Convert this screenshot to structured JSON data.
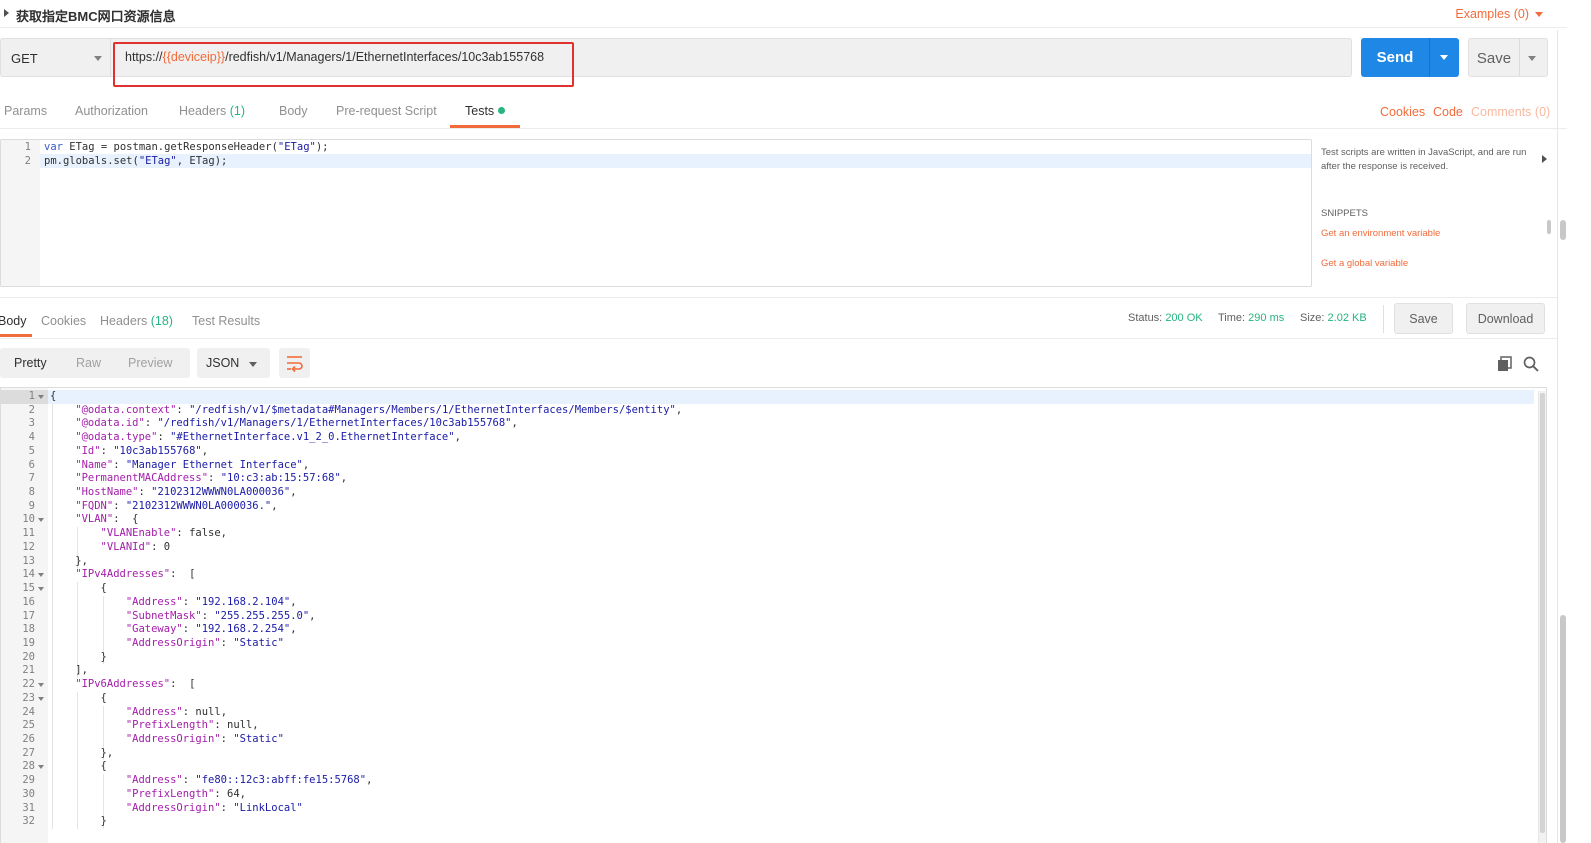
{
  "titlebar": {
    "title": "获取指定BMC网口资源信息",
    "examples": "Examples (0)"
  },
  "request": {
    "method": "GET",
    "url_prefix": "https://",
    "url_var": "{{deviceip}}",
    "url_suffix": "/redfish/v1/Managers/1/EthernetInterfaces/10c3ab155768",
    "send_label": "Send",
    "save_label": "Save"
  },
  "req_tabs": {
    "params": "Params",
    "authorization": "Authorization",
    "headers": "Headers",
    "headers_count": "(1)",
    "body": "Body",
    "prerequest": "Pre-request Script",
    "tests": "Tests",
    "cookies": "Cookies",
    "code": "Code",
    "comments": "Comments (0)"
  },
  "tests_editor": {
    "lines": [
      {
        "n": "1",
        "a": "var",
        "b": " ETag = postman.getResponseHeader(",
        "c": "\"ETag\"",
        "d": ");"
      },
      {
        "n": "2",
        "a": "",
        "b": "pm.globals.set(",
        "c": "\"ETag\"",
        "d": ", ETag);"
      }
    ]
  },
  "snippets": {
    "help": "Test scripts are written in JavaScript, and are run after the response is received.",
    "heading": "SNIPPETS",
    "items": [
      "Get an environment variable",
      "Get a global variable"
    ]
  },
  "response": {
    "tabs": {
      "body": "Body",
      "cookies": "Cookies",
      "headers": "Headers",
      "headers_count": "(18)",
      "test_results": "Test Results"
    },
    "status_label": "Status:",
    "status_value": "200 OK",
    "time_label": "Time:",
    "time_value": "290 ms",
    "size_label": "Size:",
    "size_value": "2.02 KB",
    "save_label": "Save",
    "download_label": "Download",
    "view_modes": [
      "Pretty",
      "Raw",
      "Preview"
    ],
    "format": "JSON"
  },
  "body_lines": [
    {
      "n": "1",
      "fold": true,
      "ind": 0,
      "k": "",
      "v": "",
      "p": "{"
    },
    {
      "n": "2",
      "fold": false,
      "ind": 1,
      "k": "\"@odata.context\"",
      "v": "\"/redfish/v1/$metadata#Managers/Members/1/EthernetInterfaces/Members/$entity\"",
      "p": ","
    },
    {
      "n": "3",
      "fold": false,
      "ind": 1,
      "k": "\"@odata.id\"",
      "v": "\"/redfish/v1/Managers/1/EthernetInterfaces/10c3ab155768\"",
      "p": ","
    },
    {
      "n": "4",
      "fold": false,
      "ind": 1,
      "k": "\"@odata.type\"",
      "v": "\"#EthernetInterface.v1_2_0.EthernetInterface\"",
      "p": ","
    },
    {
      "n": "5",
      "fold": false,
      "ind": 1,
      "k": "\"Id\"",
      "v": "\"10c3ab155768\"",
      "p": ","
    },
    {
      "n": "6",
      "fold": false,
      "ind": 1,
      "k": "\"Name\"",
      "v": "\"Manager Ethernet Interface\"",
      "p": ","
    },
    {
      "n": "7",
      "fold": false,
      "ind": 1,
      "k": "\"PermanentMACAddress\"",
      "v": "\"10:c3:ab:15:57:68\"",
      "p": ","
    },
    {
      "n": "8",
      "fold": false,
      "ind": 1,
      "k": "\"HostName\"",
      "v": "\"2102312WWWN0LA000036\"",
      "p": ","
    },
    {
      "n": "9",
      "fold": false,
      "ind": 1,
      "k": "\"FQDN\"",
      "v": "\"2102312WWWN0LA000036.\"",
      "p": ","
    },
    {
      "n": "10",
      "fold": true,
      "ind": 1,
      "k": "\"VLAN\"",
      "v": "",
      "p": " {"
    },
    {
      "n": "11",
      "fold": false,
      "ind": 2,
      "k": "\"VLANEnable\"",
      "v": "false",
      "p": ",",
      "raw": true
    },
    {
      "n": "12",
      "fold": false,
      "ind": 2,
      "k": "\"VLANId\"",
      "v": "0",
      "p": "",
      "raw": true
    },
    {
      "n": "13",
      "fold": false,
      "ind": 1,
      "k": "",
      "v": "",
      "p": "},"
    },
    {
      "n": "14",
      "fold": true,
      "ind": 1,
      "k": "\"IPv4Addresses\"",
      "v": "",
      "p": " ["
    },
    {
      "n": "15",
      "fold": true,
      "ind": 2,
      "k": "",
      "v": "",
      "p": "{"
    },
    {
      "n": "16",
      "fold": false,
      "ind": 3,
      "k": "\"Address\"",
      "v": "\"192.168.2.104\"",
      "p": ","
    },
    {
      "n": "17",
      "fold": false,
      "ind": 3,
      "k": "\"SubnetMask\"",
      "v": "\"255.255.255.0\"",
      "p": ","
    },
    {
      "n": "18",
      "fold": false,
      "ind": 3,
      "k": "\"Gateway\"",
      "v": "\"192.168.2.254\"",
      "p": ","
    },
    {
      "n": "19",
      "fold": false,
      "ind": 3,
      "k": "\"AddressOrigin\"",
      "v": "\"Static\"",
      "p": ""
    },
    {
      "n": "20",
      "fold": false,
      "ind": 2,
      "k": "",
      "v": "",
      "p": "}"
    },
    {
      "n": "21",
      "fold": false,
      "ind": 1,
      "k": "",
      "v": "",
      "p": "],"
    },
    {
      "n": "22",
      "fold": true,
      "ind": 1,
      "k": "\"IPv6Addresses\"",
      "v": "",
      "p": " ["
    },
    {
      "n": "23",
      "fold": true,
      "ind": 2,
      "k": "",
      "v": "",
      "p": "{"
    },
    {
      "n": "24",
      "fold": false,
      "ind": 3,
      "k": "\"Address\"",
      "v": "null",
      "p": ",",
      "raw": true
    },
    {
      "n": "25",
      "fold": false,
      "ind": 3,
      "k": "\"PrefixLength\"",
      "v": "null",
      "p": ",",
      "raw": true
    },
    {
      "n": "26",
      "fold": false,
      "ind": 3,
      "k": "\"AddressOrigin\"",
      "v": "\"Static\"",
      "p": ""
    },
    {
      "n": "27",
      "fold": false,
      "ind": 2,
      "k": "",
      "v": "",
      "p": "},"
    },
    {
      "n": "28",
      "fold": true,
      "ind": 2,
      "k": "",
      "v": "",
      "p": "{"
    },
    {
      "n": "29",
      "fold": false,
      "ind": 3,
      "k": "\"Address\"",
      "v": "\"fe80::12c3:abff:fe15:5768\"",
      "p": ","
    },
    {
      "n": "30",
      "fold": false,
      "ind": 3,
      "k": "\"PrefixLength\"",
      "v": "64",
      "p": ",",
      "raw": true
    },
    {
      "n": "31",
      "fold": false,
      "ind": 3,
      "k": "\"AddressOrigin\"",
      "v": "\"LinkLocal\"",
      "p": ""
    },
    {
      "n": "32",
      "fold": false,
      "ind": 2,
      "k": "",
      "v": "",
      "p": "}"
    }
  ],
  "colors": {
    "accent": "#f26b3a",
    "send": "#1f87e5",
    "success": "#26b47f",
    "highlight": "#e03030"
  }
}
